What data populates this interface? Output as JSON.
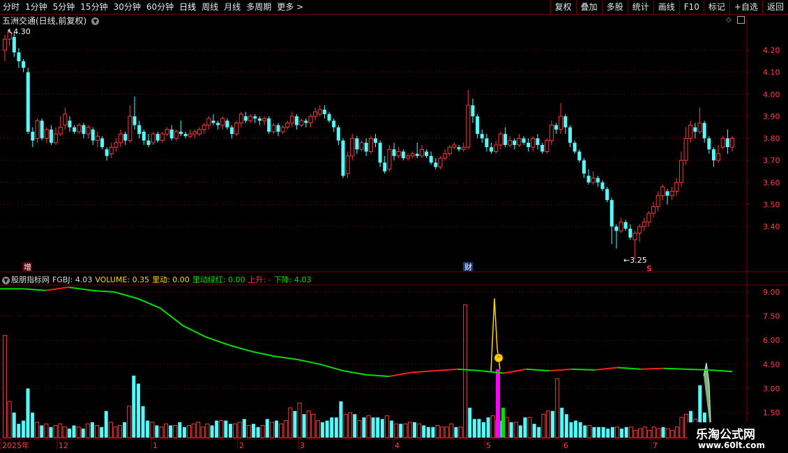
{
  "toolbar": {
    "periods": [
      "分时",
      "1分钟",
      "5分钟",
      "15分钟",
      "30分钟",
      "60分钟",
      "日线",
      "周线",
      "月线",
      "多周期",
      "更多 >"
    ],
    "active": "日线",
    "right_buttons": [
      "复权",
      "叠加",
      "多股",
      "统计",
      "画线",
      "F10",
      "标记",
      "+自选",
      "返回"
    ]
  },
  "main_chart": {
    "title": "五洲交通(日线,前复权)",
    "high_label": "4.30",
    "low_label": "3.25",
    "event_labels": [
      "增",
      "财"
    ],
    "s_marker": "S",
    "y_ticks": [
      "4.20",
      "4.10",
      "4.00",
      "3.90",
      "3.80",
      "3.70",
      "3.60",
      "3.50",
      "3.40"
    ]
  },
  "indicator": {
    "name": "股朋指标网",
    "fgbj": "FGBJ: 4.03",
    "volume": "VOLUME: 0.35",
    "liangdong": "里动: 0.00",
    "liangdong_lv": "里动绿红: 0.00",
    "shangsheng": "上升: -",
    "xiajiang": "下降: 4.03",
    "y_ticks": [
      "9.00",
      "7.50",
      "6.00",
      "4.50",
      "3.00",
      "1.50"
    ]
  },
  "x_axis": {
    "labels": [
      "2025年",
      "12",
      "1",
      "2",
      "3",
      "4",
      "5",
      "6",
      "7"
    ]
  },
  "watermark": {
    "line1": "乐淘公式网",
    "line2": "www.60lt.com"
  },
  "colors": {
    "up": "#ff3c3c",
    "down": "#54ffff",
    "grid": "#7a0000",
    "green": "#00e000",
    "magenta": "#ff00ff",
    "yellow": "#ffd700"
  },
  "chart_data": {
    "type": "candlestick",
    "ylim": [
      3.2,
      4.3
    ],
    "candles": [
      [
        4.2,
        4.25,
        4.15,
        4.27
      ],
      [
        4.25,
        4.28,
        4.22,
        4.3
      ],
      [
        4.26,
        4.19,
        4.17,
        4.28
      ],
      [
        4.19,
        4.15,
        4.12,
        4.21
      ],
      [
        4.15,
        4.12,
        4.1,
        4.16
      ],
      [
        4.1,
        3.83,
        3.82,
        4.12
      ],
      [
        3.83,
        3.79,
        3.76,
        3.85
      ],
      [
        3.8,
        3.88,
        3.78,
        3.89
      ],
      [
        3.88,
        3.8,
        3.79,
        3.89
      ],
      [
        3.8,
        3.84,
        3.78,
        3.85
      ],
      [
        3.84,
        3.78,
        3.77,
        3.86
      ],
      [
        3.78,
        3.82,
        3.77,
        3.85
      ],
      [
        3.82,
        3.85,
        3.81,
        3.9
      ],
      [
        3.86,
        3.91,
        3.84,
        3.94
      ],
      [
        3.88,
        3.85,
        3.83,
        3.9
      ],
      [
        3.85,
        3.83,
        3.82,
        3.86
      ],
      [
        3.83,
        3.86,
        3.82,
        3.87
      ],
      [
        3.86,
        3.82,
        3.8,
        3.87
      ],
      [
        3.82,
        3.85,
        3.8,
        3.86
      ],
      [
        3.84,
        3.79,
        3.77,
        3.85
      ],
      [
        3.79,
        3.81,
        3.76,
        3.83
      ],
      [
        3.8,
        3.76,
        3.75,
        3.81
      ],
      [
        3.75,
        3.72,
        3.7,
        3.76
      ],
      [
        3.73,
        3.76,
        3.71,
        3.78
      ],
      [
        3.76,
        3.78,
        3.74,
        3.8
      ],
      [
        3.78,
        3.82,
        3.76,
        3.84
      ],
      [
        3.82,
        3.79,
        3.77,
        3.83
      ],
      [
        3.79,
        3.9,
        3.78,
        3.95
      ],
      [
        3.9,
        3.86,
        3.84,
        3.99
      ],
      [
        3.86,
        3.82,
        3.8,
        3.88
      ],
      [
        3.83,
        3.79,
        3.77,
        3.84
      ],
      [
        3.79,
        3.77,
        3.76,
        3.82
      ],
      [
        3.78,
        3.82,
        3.77,
        3.83
      ],
      [
        3.82,
        3.79,
        3.78,
        3.83
      ],
      [
        3.79,
        3.82,
        3.78,
        3.83
      ],
      [
        3.82,
        3.84,
        3.81,
        3.85
      ],
      [
        3.84,
        3.8,
        3.79,
        3.86
      ],
      [
        3.8,
        3.83,
        3.79,
        3.84
      ],
      [
        3.83,
        3.82,
        3.81,
        3.88
      ],
      [
        3.82,
        3.81,
        3.8,
        3.83
      ],
      [
        3.81,
        3.82,
        3.8,
        3.84
      ],
      [
        3.82,
        3.83,
        3.8,
        3.84
      ],
      [
        3.82,
        3.84,
        3.81,
        3.85
      ],
      [
        3.84,
        3.86,
        3.82,
        3.87
      ],
      [
        3.86,
        3.89,
        3.84,
        3.9
      ],
      [
        3.88,
        3.87,
        3.86,
        3.91
      ],
      [
        3.87,
        3.86,
        3.84,
        3.88
      ],
      [
        3.86,
        3.89,
        3.84,
        3.9
      ],
      [
        3.88,
        3.85,
        3.84,
        3.89
      ],
      [
        3.85,
        3.82,
        3.8,
        3.86
      ],
      [
        3.82,
        3.87,
        3.81,
        3.88
      ],
      [
        3.87,
        3.91,
        3.85,
        3.92
      ],
      [
        3.9,
        3.88,
        3.87,
        3.92
      ],
      [
        3.88,
        3.9,
        3.87,
        3.91
      ],
      [
        3.9,
        3.89,
        3.87,
        3.91
      ],
      [
        3.89,
        3.88,
        3.86,
        3.9
      ],
      [
        3.88,
        3.89,
        3.86,
        3.9
      ],
      [
        3.89,
        3.83,
        3.82,
        3.9
      ],
      [
        3.83,
        3.86,
        3.82,
        3.87
      ],
      [
        3.86,
        3.83,
        3.81,
        3.87
      ],
      [
        3.83,
        3.85,
        3.82,
        3.86
      ],
      [
        3.85,
        3.87,
        3.84,
        3.88
      ],
      [
        3.87,
        3.9,
        3.85,
        3.92
      ],
      [
        3.9,
        3.86,
        3.84,
        3.91
      ],
      [
        3.86,
        3.88,
        3.85,
        3.89
      ],
      [
        3.88,
        3.87,
        3.85,
        3.89
      ],
      [
        3.87,
        3.9,
        3.85,
        3.91
      ],
      [
        3.9,
        3.92,
        3.88,
        3.94
      ],
      [
        3.91,
        3.93,
        3.9,
        3.95
      ],
      [
        3.93,
        3.91,
        3.89,
        3.95
      ],
      [
        3.91,
        3.88,
        3.87,
        3.92
      ],
      [
        3.88,
        3.85,
        3.83,
        3.89
      ],
      [
        3.85,
        3.79,
        3.77,
        3.86
      ],
      [
        3.79,
        3.63,
        3.62,
        3.8
      ],
      [
        3.64,
        3.72,
        3.62,
        3.74
      ],
      [
        3.72,
        3.8,
        3.7,
        3.82
      ],
      [
        3.8,
        3.75,
        3.73,
        3.81
      ],
      [
        3.75,
        3.78,
        3.74,
        3.79
      ],
      [
        3.78,
        3.74,
        3.72,
        3.8
      ],
      [
        3.74,
        3.8,
        3.73,
        3.81
      ],
      [
        3.8,
        3.78,
        3.76,
        3.82
      ],
      [
        3.78,
        3.69,
        3.67,
        3.79
      ],
      [
        3.69,
        3.65,
        3.64,
        3.72
      ],
      [
        3.66,
        3.75,
        3.65,
        3.77
      ],
      [
        3.75,
        3.72,
        3.7,
        3.78
      ],
      [
        3.72,
        3.74,
        3.71,
        3.76
      ],
      [
        3.74,
        3.71,
        3.7,
        3.75
      ],
      [
        3.71,
        3.72,
        3.7,
        3.73
      ],
      [
        3.72,
        3.73,
        3.71,
        3.74
      ],
      [
        3.73,
        3.72,
        3.71,
        3.78
      ],
      [
        3.72,
        3.75,
        3.71,
        3.77
      ],
      [
        3.74,
        3.72,
        3.71,
        3.75
      ],
      [
        3.72,
        3.69,
        3.68,
        3.74
      ],
      [
        3.69,
        3.67,
        3.66,
        3.71
      ],
      [
        3.67,
        3.71,
        3.66,
        3.72
      ],
      [
        3.71,
        3.73,
        3.7,
        3.75
      ],
      [
        3.73,
        3.76,
        3.72,
        3.77
      ],
      [
        3.76,
        3.77,
        3.75,
        3.78
      ],
      [
        3.76,
        3.75,
        3.74,
        3.77
      ],
      [
        3.75,
        3.76,
        3.74,
        3.78
      ],
      [
        3.76,
        3.95,
        3.75,
        4.02
      ],
      [
        3.95,
        3.9,
        3.87,
        3.98
      ],
      [
        3.9,
        3.82,
        3.8,
        3.91
      ],
      [
        3.82,
        3.8,
        3.78,
        3.84
      ],
      [
        3.8,
        3.76,
        3.74,
        3.82
      ],
      [
        3.76,
        3.74,
        3.73,
        3.78
      ],
      [
        3.74,
        3.77,
        3.73,
        3.79
      ],
      [
        3.77,
        3.82,
        3.75,
        3.83
      ],
      [
        3.82,
        3.77,
        3.76,
        3.85
      ],
      [
        3.77,
        3.79,
        3.76,
        3.81
      ],
      [
        3.79,
        3.77,
        3.75,
        3.8
      ],
      [
        3.77,
        3.8,
        3.76,
        3.82
      ],
      [
        3.8,
        3.78,
        3.77,
        3.81
      ],
      [
        3.78,
        3.76,
        3.74,
        3.8
      ],
      [
        3.76,
        3.8,
        3.74,
        3.81
      ],
      [
        3.8,
        3.77,
        3.75,
        3.82
      ],
      [
        3.77,
        3.74,
        3.73,
        3.78
      ],
      [
        3.74,
        3.79,
        3.73,
        3.8
      ],
      [
        3.79,
        3.86,
        3.77,
        3.88
      ],
      [
        3.86,
        3.84,
        3.82,
        3.87
      ],
      [
        3.84,
        3.9,
        3.82,
        3.96
      ],
      [
        3.9,
        3.85,
        3.82,
        3.91
      ],
      [
        3.85,
        3.78,
        3.76,
        3.86
      ],
      [
        3.78,
        3.74,
        3.73,
        3.79
      ],
      [
        3.74,
        3.7,
        3.69,
        3.75
      ],
      [
        3.7,
        3.64,
        3.62,
        3.71
      ],
      [
        3.63,
        3.6,
        3.59,
        3.66
      ],
      [
        3.6,
        3.62,
        3.59,
        3.65
      ],
      [
        3.62,
        3.6,
        3.58,
        3.63
      ],
      [
        3.6,
        3.57,
        3.56,
        3.61
      ],
      [
        3.57,
        3.52,
        3.51,
        3.58
      ],
      [
        3.52,
        3.4,
        3.32,
        3.53
      ],
      [
        3.4,
        3.38,
        3.3,
        3.41
      ],
      [
        3.38,
        3.42,
        3.37,
        3.44
      ],
      [
        3.42,
        3.39,
        3.38,
        3.43
      ],
      [
        3.39,
        3.35,
        3.34,
        3.41
      ],
      [
        3.34,
        3.37,
        3.25,
        3.38
      ],
      [
        3.37,
        3.4,
        3.33,
        3.41
      ],
      [
        3.4,
        3.42,
        3.38,
        3.44
      ],
      [
        3.42,
        3.46,
        3.4,
        3.47
      ],
      [
        3.46,
        3.49,
        3.44,
        3.51
      ],
      [
        3.49,
        3.54,
        3.47,
        3.56
      ],
      [
        3.54,
        3.58,
        3.52,
        3.59
      ],
      [
        3.56,
        3.54,
        3.5,
        3.57
      ],
      [
        3.54,
        3.56,
        3.52,
        3.58
      ],
      [
        3.56,
        3.6,
        3.54,
        3.62
      ],
      [
        3.6,
        3.7,
        3.58,
        3.74
      ],
      [
        3.7,
        3.8,
        3.68,
        3.85
      ],
      [
        3.8,
        3.86,
        3.78,
        3.88
      ],
      [
        3.85,
        3.83,
        3.8,
        3.87
      ],
      [
        3.83,
        3.87,
        3.82,
        3.94
      ],
      [
        3.87,
        3.8,
        3.78,
        3.88
      ],
      [
        3.8,
        3.75,
        3.73,
        3.81
      ],
      [
        3.75,
        3.7,
        3.67,
        3.76
      ],
      [
        3.7,
        3.73,
        3.69,
        3.77
      ],
      [
        3.76,
        3.8,
        3.75,
        3.81
      ],
      [
        3.8,
        3.76,
        3.73,
        3.84
      ],
      [
        3.76,
        3.8,
        3.74,
        3.81
      ]
    ],
    "volume": [
      6.3,
      2.2,
      1.5,
      0.8,
      1.0,
      3.0,
      1.5,
      0.9,
      0.7,
      0.8,
      0.6,
      0.7,
      0.8,
      0.6,
      0.5,
      0.7,
      0.6,
      0.5,
      0.8,
      0.9,
      0.7,
      0.6,
      1.6,
      0.9,
      0.6,
      0.7,
      0.9,
      1.9,
      3.8,
      3.3,
      1.9,
      1.0,
      0.9,
      0.7,
      0.6,
      0.8,
      0.7,
      0.7,
      0.9,
      0.6,
      0.7,
      0.8,
      0.9,
      0.6,
      0.8,
      0.7,
      1.0,
      1.0,
      1.0,
      0.8,
      0.8,
      0.9,
      1.1,
      0.7,
      0.8,
      0.6,
      0.7,
      1.1,
      0.9,
      1.0,
      0.8,
      1.0,
      1.8,
      1.6,
      2.1,
      1.4,
      1.6,
      1.4,
      1.0,
      0.9,
      1.0,
      1.2,
      1.2,
      2.2,
      1.4,
      1.5,
      1.4,
      1.0,
      1.2,
      1.3,
      1.2,
      1.2,
      1.1,
      1.3,
      1.0,
      0.8,
      0.8,
      0.8,
      0.9,
      0.9,
      0.8,
      0.7,
      0.6,
      0.6,
      0.7,
      0.6,
      0.6,
      0.8,
      0.6,
      0.6,
      8.2,
      1.8,
      1.1,
      1.1,
      0.9,
      1.2,
      1.3,
      1.0,
      1.0,
      1.2,
      0.9,
      0.9,
      0.7,
      1.2,
      1.2,
      0.8,
      0.6,
      1.4,
      1.6,
      1.6,
      3.6,
      1.8,
      1.4,
      0.9,
      1.0,
      0.9,
      0.7,
      0.7,
      0.6,
      0.6,
      0.6,
      0.5,
      0.6,
      0.6,
      0.5,
      0.6,
      0.6,
      0.4,
      0.5,
      0.6,
      0.4,
      0.6,
      0.5,
      0.6,
      0.5,
      0.4,
      0.6,
      1.2,
      1.4,
      1.6,
      1.1,
      3.2,
      1.5,
      0.9,
      0.8,
      0.6,
      0.6,
      0.6,
      0.5
    ],
    "fgbj_line": [
      9.2,
      9.2,
      9.1,
      9.3,
      9.1,
      9.0,
      8.6,
      8.0,
      6.9,
      6.2,
      5.7,
      5.3,
      5.0,
      4.8,
      4.5,
      4.1,
      3.85,
      3.75,
      4.0,
      4.1,
      4.2,
      4.1,
      3.95,
      4.2,
      4.1,
      4.2,
      4.15,
      4.3,
      4.2,
      4.25,
      4.2,
      4.15,
      4.05
    ]
  }
}
